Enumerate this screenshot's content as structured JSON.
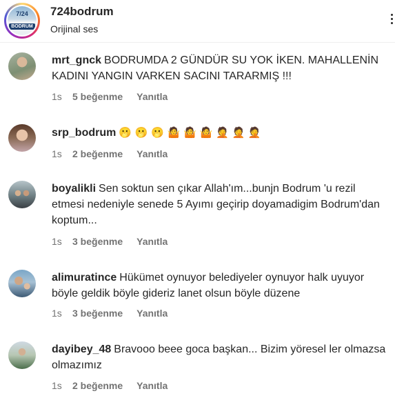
{
  "header": {
    "title": "724bodrum",
    "subtitle": "Orijinal ses",
    "logo_number": "7/24",
    "logo_word": "BODRUM"
  },
  "comments": [
    {
      "username": "mrt_gnck",
      "text": "BODRUMDA 2 GÜNDÜR SU YOK İKEN. MAHALLENİN KADINI YANGIN VARKEN SACINI TARARMIŞ !!!",
      "time": "1s",
      "likes": "5 beğenme",
      "reply": "Yanıtla"
    },
    {
      "username": "srp_bodrum",
      "text": "🫢 🫢 🫢 🤷 🤷 🤷 🤦 🤦 🤦",
      "time": "1s",
      "likes": "2 beğenme",
      "reply": "Yanıtla"
    },
    {
      "username": "boyalikli",
      "text": "Sen soktun sen çıkar Allah'ım...bunjn Bodrum 'u rezil etmesi nedeniyle senede 5 Ayımı geçirip doyamadigim Bodrum'dan koptum...",
      "time": "1s",
      "likes": "3 beğenme",
      "reply": "Yanıtla"
    },
    {
      "username": "alimuratince",
      "text": "Hükümet oynuyor belediyeler oynuyor halk uyuyor böyle geldik böyle gideriz lanet olsun böyle düzene",
      "time": "1s",
      "likes": "3 beğenme",
      "reply": "Yanıtla"
    },
    {
      "username": "dayibey_48",
      "text": "Bravooo beee goca başkan... Bizim yöresel ler olmazsa olmazımız",
      "time": "1s",
      "likes": "2 beğenme",
      "reply": "Yanıtla"
    }
  ],
  "icons": {
    "more": "more-horizontal-icon"
  }
}
